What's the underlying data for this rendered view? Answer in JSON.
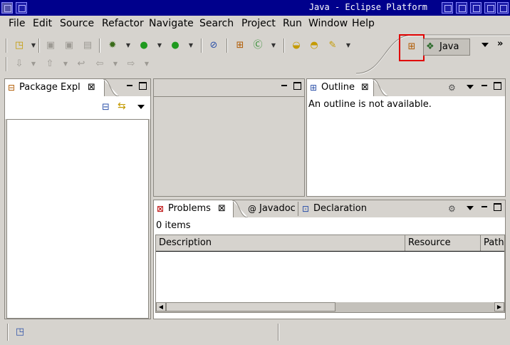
{
  "window": {
    "title": "Java - Eclipse Platform",
    "buttons": [
      "icon-icon",
      "shade-icon",
      "minimize-icon",
      "maximize-icon",
      "close-icon"
    ]
  },
  "menu": {
    "items": [
      "File",
      "Edit",
      "Source",
      "Refactor",
      "Navigate",
      "Search",
      "Project",
      "Run",
      "Window",
      "Help"
    ]
  },
  "perspective": {
    "open_perspective_icon": "open-perspective-icon",
    "current": "Java",
    "overflow": "»"
  },
  "package_explorer": {
    "tab_label": "Package Expl",
    "close": "⊠"
  },
  "outline": {
    "tab_label": "Outline",
    "close": "⊠",
    "message": "An outline is not available."
  },
  "bottom_panel": {
    "tabs": [
      {
        "label": "Problems",
        "icon": "problems-icon",
        "active": true
      },
      {
        "label": "Javadoc",
        "icon": "at-icon",
        "active": false
      },
      {
        "label": "Declaration",
        "icon": "declaration-icon",
        "active": false
      }
    ],
    "close": "⊠",
    "items_count": "0 items",
    "columns": [
      "Description",
      "Resource",
      "Path"
    ]
  },
  "colors": {
    "title_bar": "#00008c",
    "highlight": "#e00000",
    "chrome": "#d6d3ce"
  }
}
